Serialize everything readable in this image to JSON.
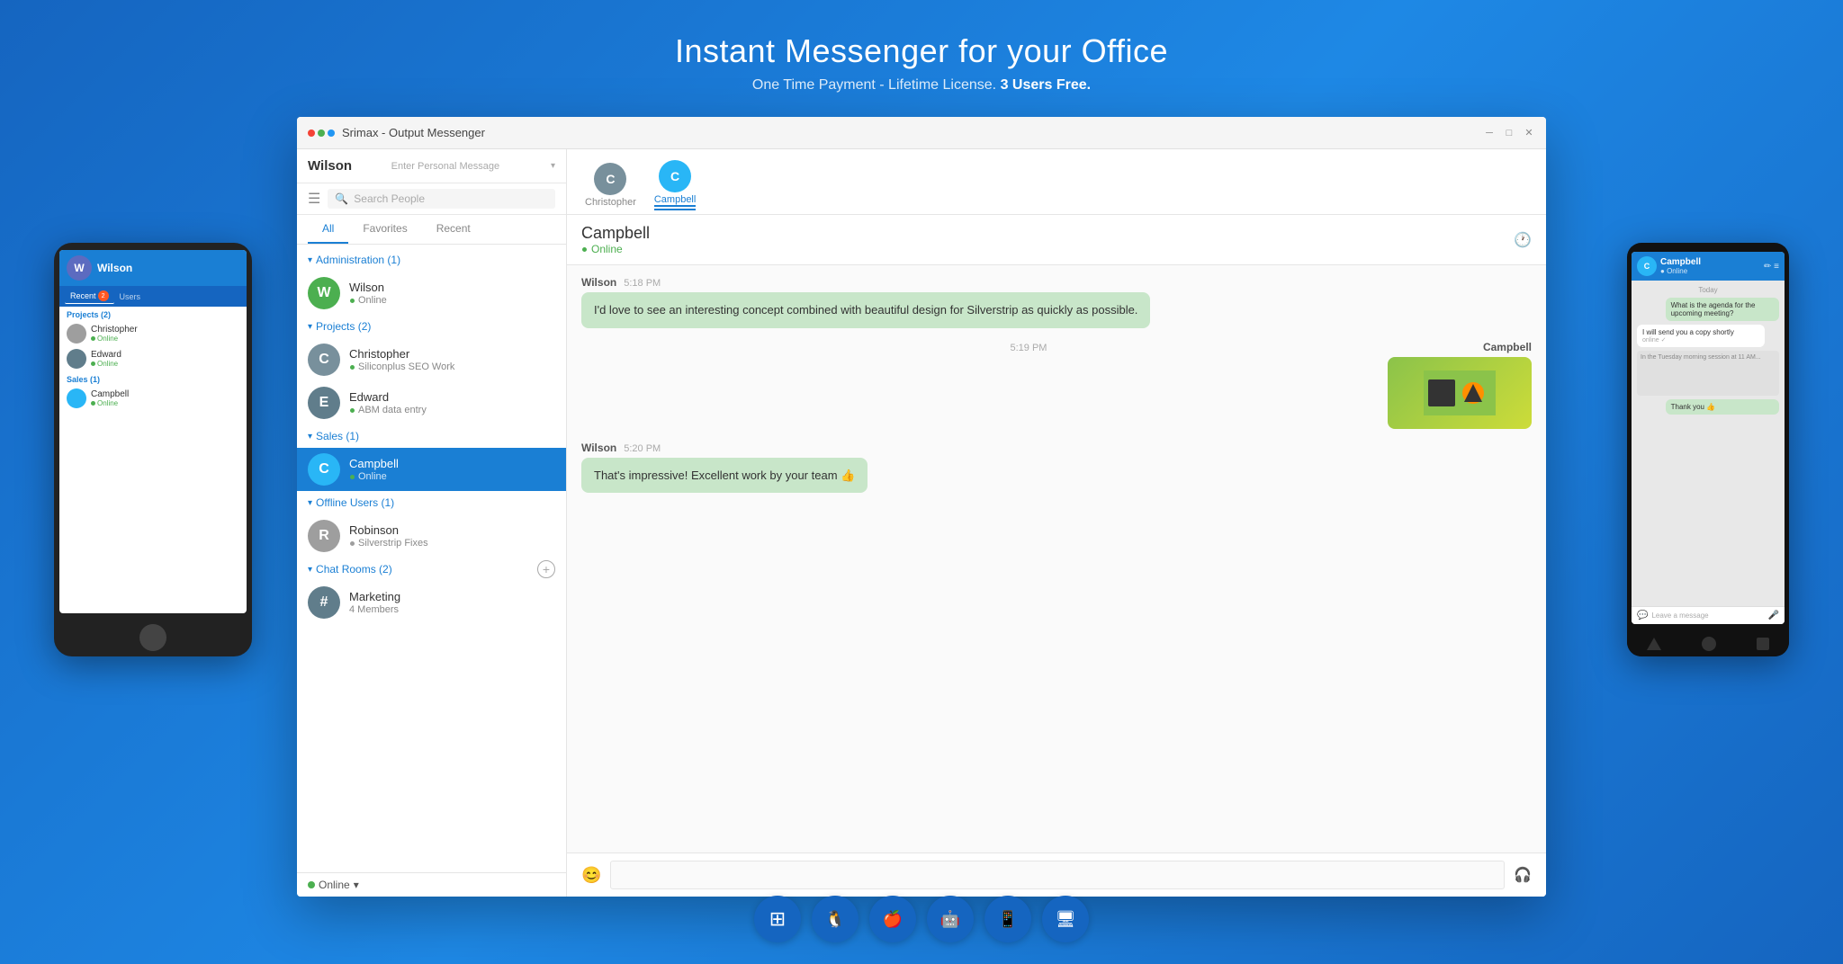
{
  "page": {
    "title": "Instant Messenger for your Office",
    "subtitle_prefix": "One Time Payment - Lifetime License.",
    "subtitle_highlight": "3 Users Free."
  },
  "window": {
    "title": "Srimax - Output Messenger",
    "min_btn": "─",
    "max_btn": "□",
    "close_btn": "✕"
  },
  "sidebar": {
    "username": "Wilson",
    "status_placeholder": "Enter Personal Message",
    "search_placeholder": "Search People",
    "tabs": [
      {
        "label": "All",
        "active": true
      },
      {
        "label": "Favorites",
        "active": false
      },
      {
        "label": "Recent",
        "active": false
      }
    ],
    "groups": [
      {
        "name": "Administration (1)",
        "contacts": [
          {
            "name": "Wilson",
            "status": "Online",
            "online": true,
            "initial": "W",
            "color": "#4caf50"
          }
        ]
      },
      {
        "name": "Projects (2)",
        "contacts": [
          {
            "name": "Christopher",
            "status": "Siliconplus SEO Work",
            "online": true,
            "initial": "C",
            "color": "#78909c"
          },
          {
            "name": "Edward",
            "status": "ABM data entry",
            "online": true,
            "initial": "E",
            "color": "#607d8b"
          }
        ]
      },
      {
        "name": "Sales (1)",
        "contacts": [
          {
            "name": "Campbell",
            "status": "Online",
            "online": true,
            "initial": "C",
            "color": "#29b6f6",
            "selected": true
          }
        ]
      },
      {
        "name": "Offline Users (1)",
        "contacts": [
          {
            "name": "Robinson",
            "status": "Silverstrip Fixes",
            "online": false,
            "initial": "R",
            "color": "#9e9e9e"
          }
        ]
      }
    ],
    "chat_rooms": {
      "label": "Chat Rooms (2)",
      "rooms": [
        {
          "name": "Marketing",
          "members": "4 Members",
          "icon": "#"
        }
      ]
    },
    "footer": {
      "status": "Online",
      "arrow": "▾"
    }
  },
  "chat": {
    "active_contact": "Campbell",
    "active_status": "Online",
    "tabs": [
      {
        "name": "Christopher",
        "initial": "C",
        "color": "#78909c",
        "active": false
      },
      {
        "name": "Campbell",
        "initial": "C",
        "color": "#29b6f6",
        "active": true
      }
    ],
    "messages": [
      {
        "sender": "Wilson",
        "time": "5:18 PM",
        "align": "left",
        "text": "I'd love to see an interesting concept combined with beautiful design for Silverstrip as quickly as possible.",
        "type": "text"
      },
      {
        "sender": "Campbell",
        "time": "5:19 PM",
        "align": "right",
        "type": "image"
      },
      {
        "sender": "Wilson",
        "time": "5:20 PM",
        "align": "left",
        "text": "That's impressive! Excellent work by your team 👍",
        "type": "text"
      }
    ]
  },
  "tablet_left": {
    "username": "Wilson",
    "tabs": [
      {
        "label": "Recent",
        "badge": "2",
        "active": true
      },
      {
        "label": "Users",
        "active": false
      }
    ],
    "sections": [
      {
        "label": "Projects (2)"
      },
      {
        "label": "Sales (1)"
      }
    ],
    "contacts": [
      {
        "name": "Christopher",
        "status": "Online"
      },
      {
        "name": "Edward",
        "status": "Online"
      },
      {
        "name": "Campbell",
        "status": "Online"
      }
    ]
  },
  "tablet_right": {
    "contact_name": "Campbell",
    "contact_status": "Online",
    "messages": [
      {
        "text": "What is the agenda for the upcoming meeting?",
        "align": "right"
      },
      {
        "text": "I will send you a copy shortly",
        "align": "left"
      },
      {
        "text": "Thank you 👍",
        "align": "right"
      }
    ],
    "input_placeholder": "Leave a message"
  },
  "platforms": [
    {
      "icon": "⊞",
      "name": "windows-icon"
    },
    {
      "icon": "🐧",
      "name": "linux-icon"
    },
    {
      "icon": "🍎",
      "name": "apple-icon"
    },
    {
      "icon": "🤖",
      "name": "android-icon"
    },
    {
      "icon": "📱",
      "name": "ios-icon"
    },
    {
      "icon": "🖥",
      "name": "desktop-icon"
    }
  ],
  "colors": {
    "brand_blue": "#1a7fd4",
    "online_green": "#4caf50",
    "selected_blue": "#1a7fd4",
    "bubble_green": "#c8e6c9"
  }
}
